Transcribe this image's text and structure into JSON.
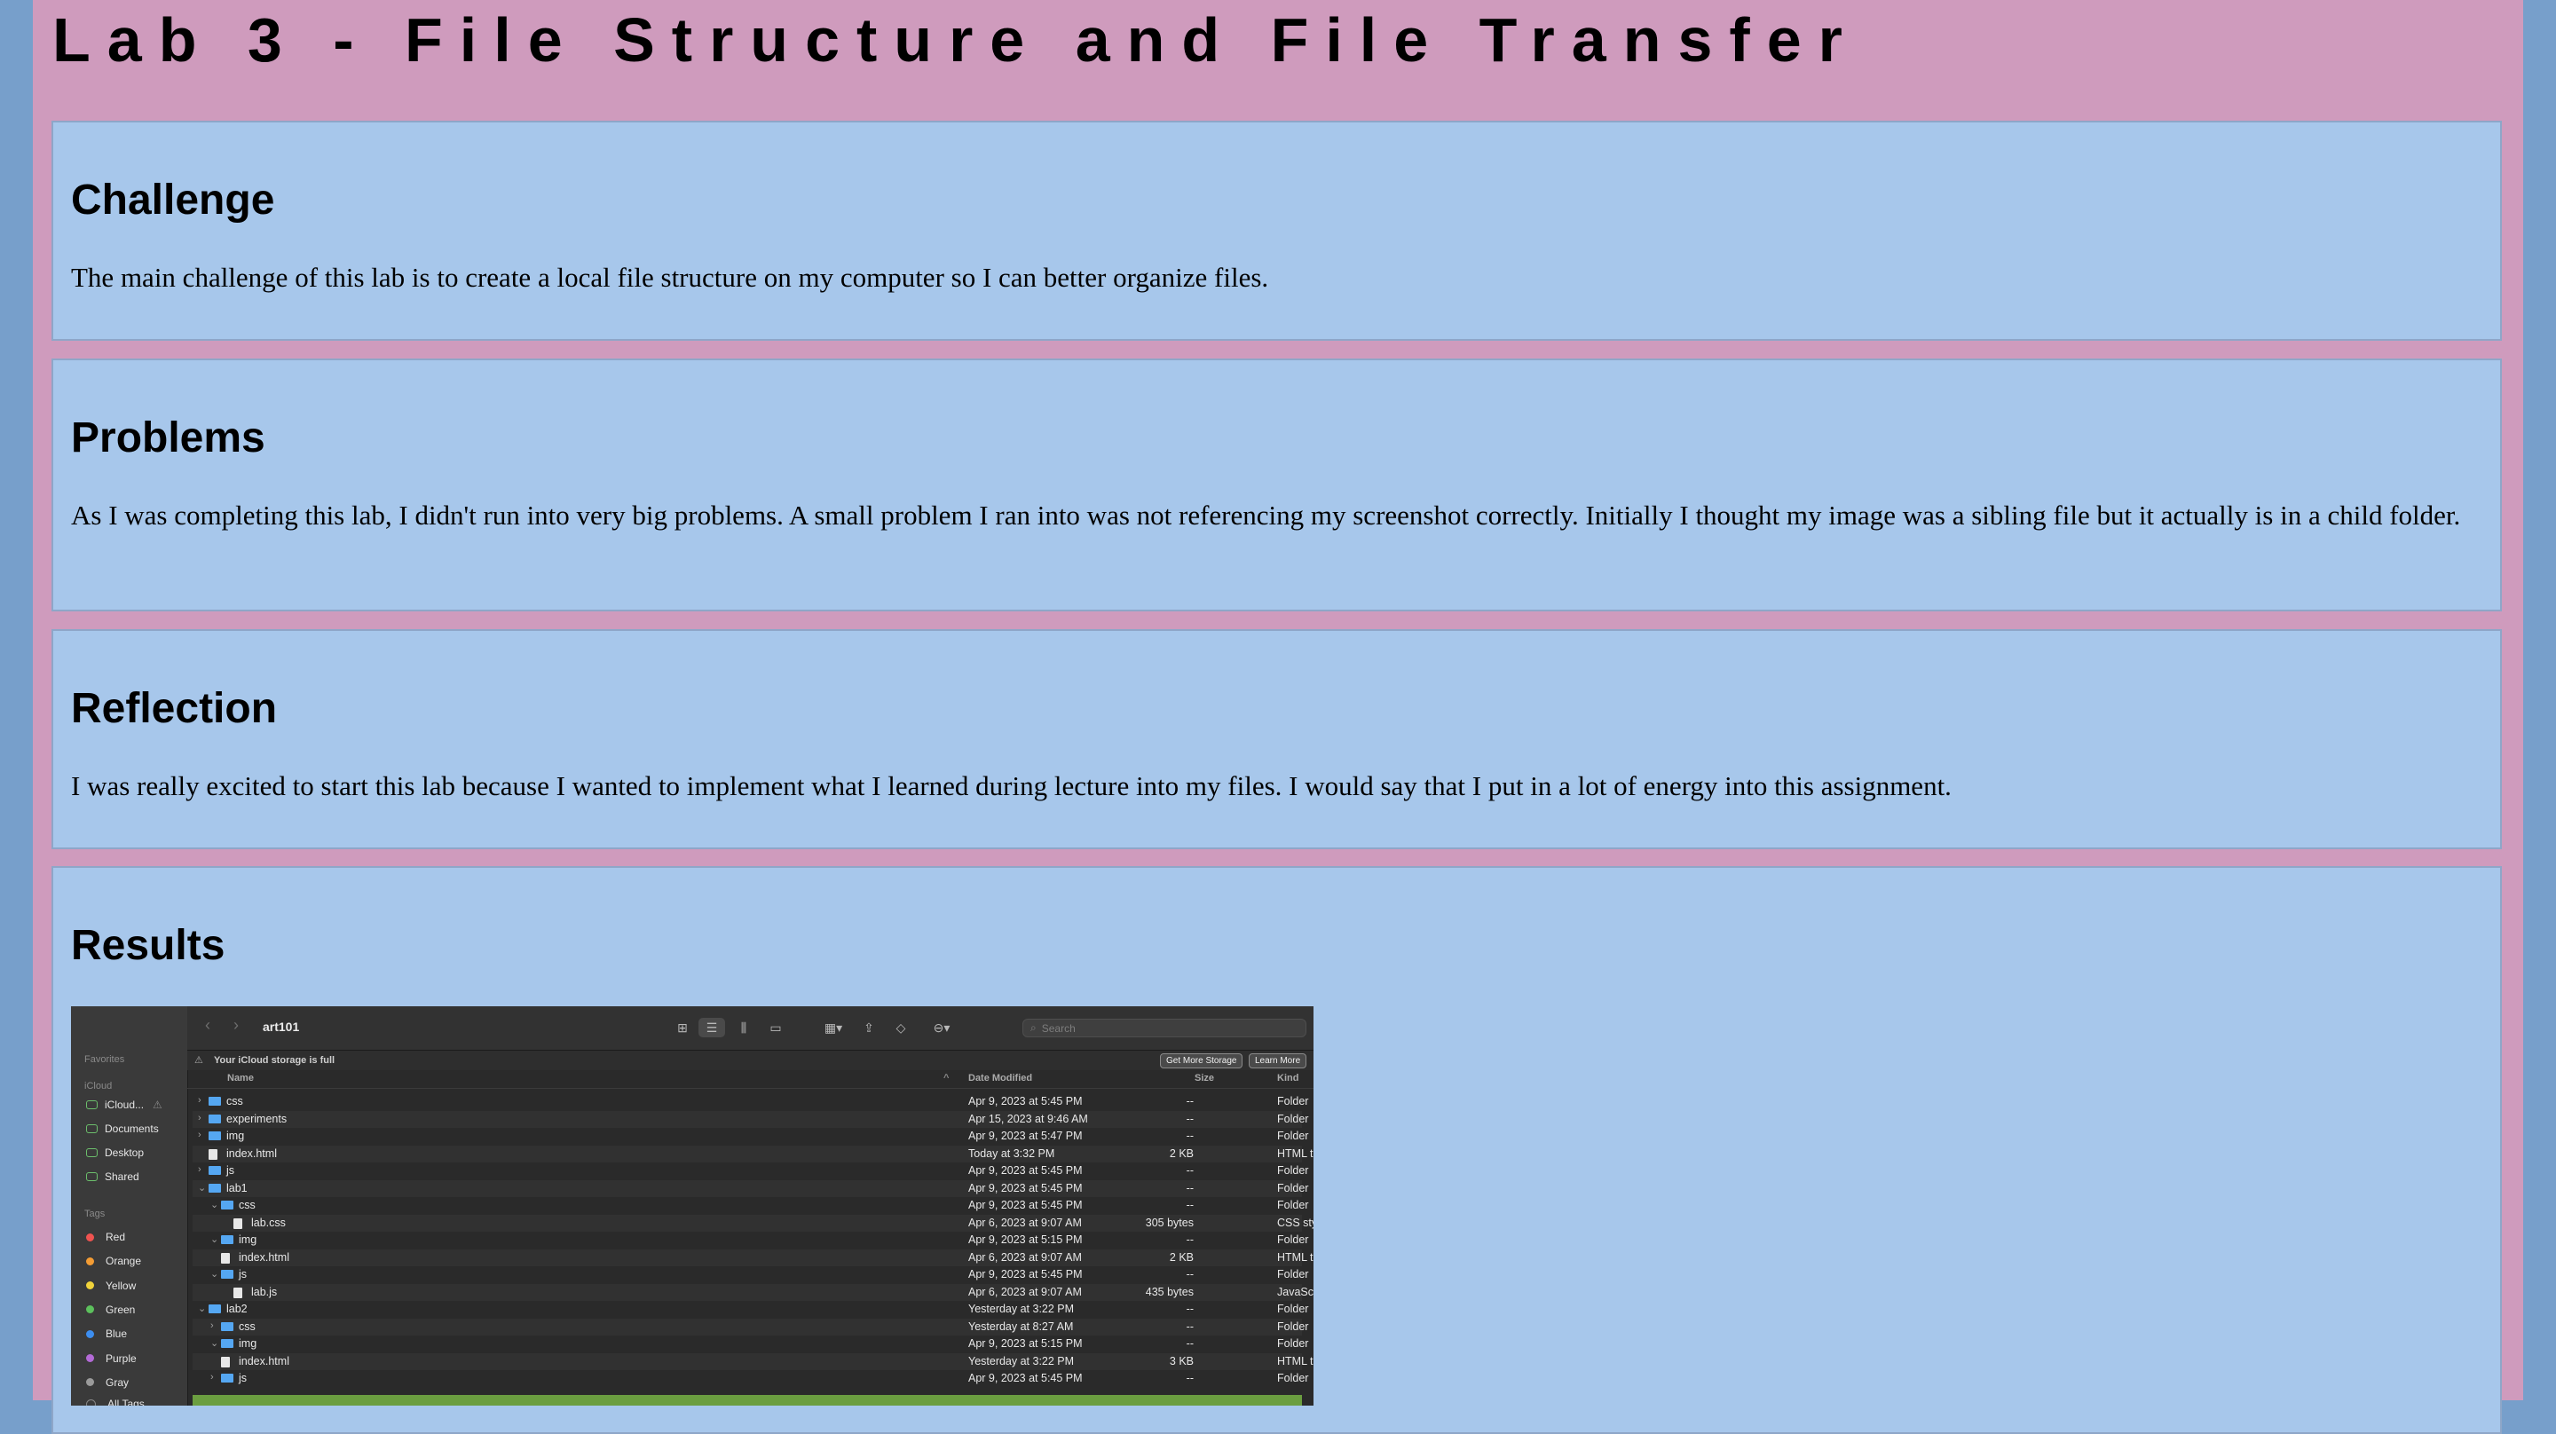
{
  "title": "Lab 3 - File Structure and File Transfer",
  "sections": [
    {
      "heading": "Challenge",
      "text": "The main challenge of this lab is to create a local file structure on my computer so I can better organize files."
    },
    {
      "heading": "Problems",
      "text": "As I was completing this lab, I didn't run into very big problems. A small problem I ran into was not referencing my screenshot correctly. Initially I thought my image was a sibling file but it actually is in a child folder."
    },
    {
      "heading": "Reflection",
      "text": "I was really excited to start this lab because I wanted to implement what I learned during lecture into my files. I would say that I put in a lot of energy into this assignment."
    },
    {
      "heading": "Results",
      "text": ""
    }
  ],
  "finder": {
    "window_title": "art101",
    "search_placeholder": "Search",
    "banner": {
      "text": "Your iCloud storage is full",
      "get_more": "Get More Storage",
      "learn_more": "Learn More"
    },
    "columns": {
      "name": "Name",
      "date": "Date Modified",
      "size": "Size",
      "kind": "Kind"
    },
    "sidebar": {
      "favorites_label": "Favorites",
      "icloud_label": "iCloud",
      "icloud_items": [
        "iCloud...",
        "Documents",
        "Desktop",
        "Shared"
      ],
      "tags_label": "Tags",
      "tags": [
        {
          "name": "Red",
          "color": "#ef5350"
        },
        {
          "name": "Orange",
          "color": "#f39c34"
        },
        {
          "name": "Yellow",
          "color": "#f1d33b"
        },
        {
          "name": "Green",
          "color": "#5cc05c"
        },
        {
          "name": "Blue",
          "color": "#3d8ef0"
        },
        {
          "name": "Purple",
          "color": "#b36ad6"
        },
        {
          "name": "Gray",
          "color": "#9a9a9a"
        }
      ],
      "all_tags": "All Tags..."
    },
    "rows": [
      {
        "name": "css",
        "indent": 0,
        "type": "folder",
        "expanded": false,
        "date": "Apr 9, 2023 at 5:45 PM",
        "size": "--",
        "kind": "Folder"
      },
      {
        "name": "experiments",
        "indent": 0,
        "type": "folder",
        "expanded": false,
        "date": "Apr 15, 2023 at 9:46 AM",
        "size": "--",
        "kind": "Folder"
      },
      {
        "name": "img",
        "indent": 0,
        "type": "folder",
        "expanded": false,
        "date": "Apr 9, 2023 at 5:47 PM",
        "size": "--",
        "kind": "Folder"
      },
      {
        "name": "index.html",
        "indent": 0,
        "type": "file",
        "date": "Today at 3:32 PM",
        "size": "2 KB",
        "kind": "HTML text"
      },
      {
        "name": "js",
        "indent": 0,
        "type": "folder",
        "expanded": false,
        "date": "Apr 9, 2023 at 5:45 PM",
        "size": "--",
        "kind": "Folder"
      },
      {
        "name": "lab1",
        "indent": 0,
        "type": "folder",
        "expanded": true,
        "date": "Apr 9, 2023 at 5:45 PM",
        "size": "--",
        "kind": "Folder"
      },
      {
        "name": "css",
        "indent": 1,
        "type": "folder",
        "expanded": true,
        "date": "Apr 9, 2023 at 5:45 PM",
        "size": "--",
        "kind": "Folder"
      },
      {
        "name": "lab.css",
        "indent": 2,
        "type": "file",
        "date": "Apr 6, 2023 at 9:07 AM",
        "size": "305 bytes",
        "kind": "CSS style sheet"
      },
      {
        "name": "img",
        "indent": 1,
        "type": "folder",
        "expanded": true,
        "date": "Apr 9, 2023 at 5:15 PM",
        "size": "--",
        "kind": "Folder"
      },
      {
        "name": "index.html",
        "indent": 1,
        "type": "file",
        "date": "Apr 6, 2023 at 9:07 AM",
        "size": "2 KB",
        "kind": "HTML text"
      },
      {
        "name": "js",
        "indent": 1,
        "type": "folder",
        "expanded": true,
        "date": "Apr 9, 2023 at 5:45 PM",
        "size": "--",
        "kind": "Folder"
      },
      {
        "name": "lab.js",
        "indent": 2,
        "type": "file",
        "date": "Apr 6, 2023 at 9:07 AM",
        "size": "435 bytes",
        "kind": "JavaSc...t script"
      },
      {
        "name": "lab2",
        "indent": 0,
        "type": "folder",
        "expanded": true,
        "date": "Yesterday at 3:22 PM",
        "size": "--",
        "kind": "Folder"
      },
      {
        "name": "css",
        "indent": 1,
        "type": "folder",
        "expanded": false,
        "date": "Yesterday at 8:27 AM",
        "size": "--",
        "kind": "Folder"
      },
      {
        "name": "img",
        "indent": 1,
        "type": "folder",
        "expanded": true,
        "date": "Apr 9, 2023 at 5:15 PM",
        "size": "--",
        "kind": "Folder"
      },
      {
        "name": "index.html",
        "indent": 1,
        "type": "file",
        "date": "Yesterday at 3:22 PM",
        "size": "3 KB",
        "kind": "HTML text"
      },
      {
        "name": "js",
        "indent": 1,
        "type": "folder",
        "expanded": false,
        "date": "Apr 9, 2023 at 5:45 PM",
        "size": "--",
        "kind": "Folder"
      }
    ]
  }
}
